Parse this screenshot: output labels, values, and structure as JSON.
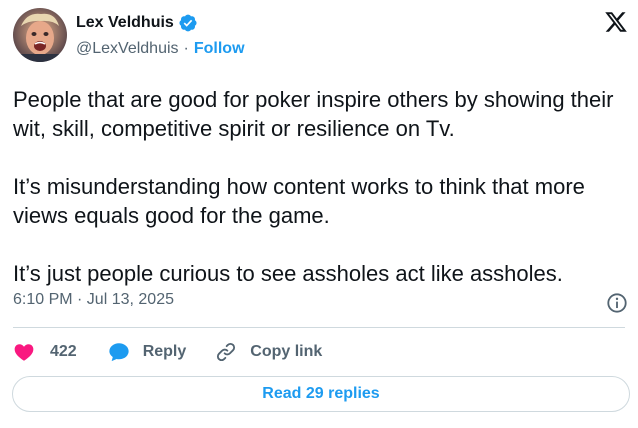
{
  "author": {
    "name": "Lex Veldhuis",
    "handle": "@LexVeldhuis",
    "separator": "·",
    "follow_label": "Follow"
  },
  "tweet": {
    "paragraphs": [
      "People that are good for poker inspire others by showing their wit, skill, competitive spirit or resilience on Tv.",
      "It’s misunderstanding how content works to think that more views equals good for the game.",
      "It’s just people curious to see assholes act like assholes."
    ],
    "timestamp": "6:10 PM · Jul 13, 2025"
  },
  "actions": {
    "like_count": "422",
    "reply_label": "Reply",
    "copy_link_label": "Copy link"
  },
  "footer": {
    "read_replies_label": "Read 29 replies"
  },
  "colors": {
    "accent": "#1d9bf0",
    "like": "#f91880",
    "text": "#0f1419",
    "muted": "#536471"
  },
  "icons": {
    "verified": "verified-badge-icon",
    "brand": "x-logo-icon",
    "info": "info-icon",
    "like": "heart-icon",
    "reply": "reply-bubble-icon",
    "copy": "link-icon"
  }
}
